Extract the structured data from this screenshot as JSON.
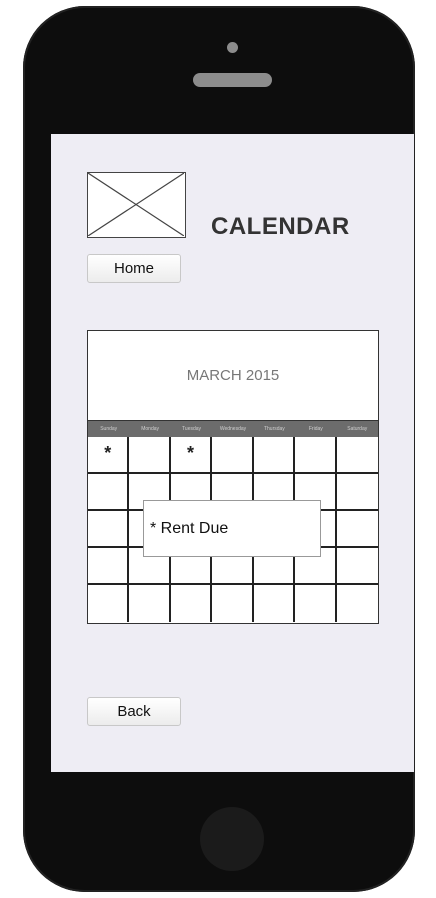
{
  "app": {
    "title": "CALENDAR",
    "home_label": "Home",
    "back_label": "Back"
  },
  "calendar": {
    "month_label": "MARCH 2015",
    "weekdays": [
      "Sunday",
      "Monday",
      "Tuesday",
      "Wednesday",
      "Thursday",
      "Friday",
      "Saturday"
    ],
    "marks": {
      "row1": [
        "*",
        "",
        "*",
        "",
        "",
        "",
        ""
      ]
    }
  },
  "popup": {
    "text": "* Rent Due"
  },
  "icons": {
    "logo": "image-placeholder-icon"
  },
  "colors": {
    "phone_body": "#0d0d0d",
    "screen_bg": "#eeedf4",
    "weekday_bar": "#6c6c6c"
  }
}
